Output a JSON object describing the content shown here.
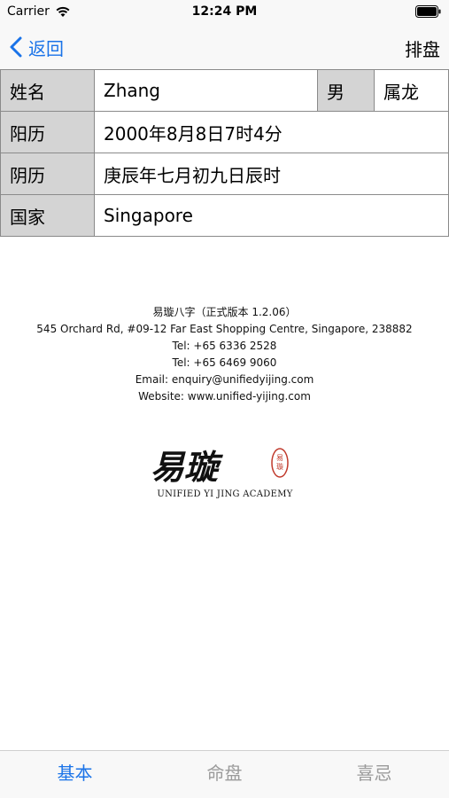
{
  "status_bar": {
    "carrier": "Carrier",
    "time": "12:24 PM",
    "icons": [
      "wifi-icon",
      "battery-icon"
    ]
  },
  "nav": {
    "back_label": "返回",
    "action_label": "排盘",
    "accent_color": "#1a73e8"
  },
  "table": {
    "name_label": "姓名",
    "name_value": "Zhang",
    "gender": "男",
    "zodiac": "属龙",
    "solar_label": "阳历",
    "solar_value": "2000年8月8日7时4分",
    "lunar_label": "阴历",
    "lunar_value": "庚辰年七月初九日辰时",
    "country_label": "国家",
    "country_value": "Singapore"
  },
  "company": {
    "app_version": "易璇八字（正式版本 1.2.06）",
    "address": "545 Orchard Rd, #09-12 Far East Shopping Centre, Singapore, 238882",
    "tel1": "Tel: +65 6336 2528",
    "tel2": "Tel: +65 6469 9060",
    "email": "Email: enquiry@unifiedyijing.com",
    "website": "Website: www.unified-yijing.com"
  },
  "logo": {
    "calligraphy": "易璇",
    "seal": "易璇",
    "name": "UNIFIED YI JING ACADEMY"
  },
  "tabs": [
    {
      "label": "基本",
      "active": true
    },
    {
      "label": "命盘",
      "active": false
    },
    {
      "label": "喜忌",
      "active": false
    }
  ]
}
